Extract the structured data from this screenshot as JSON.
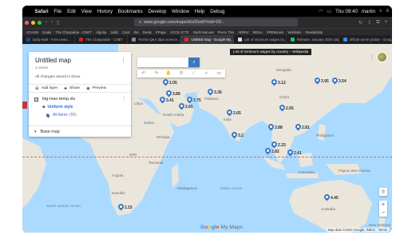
{
  "menubar": {
    "app": "Safari",
    "items": [
      "File",
      "Edit",
      "View",
      "History",
      "Bookmarks",
      "Develop",
      "Window",
      "Help",
      "Debug"
    ],
    "clock": "Thu 09:40",
    "user": "martin"
  },
  "browser": {
    "url": "www.google.com/maps/d/u/0/edit?mid=1R...",
    "favorites": [
      "4CANN",
      "Goals",
      "The Chaspalde - CNET",
      "Algolia",
      "Jalliz",
      "Card",
      "Ski",
      "Deals",
      "PPage",
      "ACCE-ICTE",
      "Dash Manual",
      "Press This",
      "ARRIV",
      "MESA",
      "#REMsuss",
      "Wikilinks",
      "Readability"
    ],
    "tabs": [
      {
        "label": "Daily Mail - Free news...",
        "active": false
      },
      {
        "label": "The Chaspadde - CNET",
        "active": false
      },
      {
        "label": "Techie Q&A data science...",
        "active": false
      },
      {
        "label": "Untitled map - Google My...",
        "active": true
      },
      {
        "label": "List of minimum wages by...",
        "active": false
      },
      {
        "label": "Release: January 2020 data...",
        "active": false
      },
      {
        "label": "official name jordan - Google...",
        "active": false
      }
    ]
  },
  "panel": {
    "title": "Untitled map",
    "views": "4 views",
    "saved": "All changes saved in Drive",
    "actions": {
      "add_layer": "Add layer",
      "share": "Share",
      "preview": "Preview"
    },
    "layer": {
      "name": "big-mac-temp.xls",
      "style": "Uniform style",
      "items_label": "All items",
      "items_count": "(55)"
    },
    "base_map": "Base map"
  },
  "tooltip": "List of minimum wages by country – Wikipedia",
  "logo": {
    "google": [
      "G",
      "o",
      "o",
      "g",
      "l",
      "e"
    ],
    "suffix": " My Maps"
  },
  "copyright": "Map data ©2020 Google, INEGI · Terms",
  "geo_labels": {
    "libya": "Libya",
    "south_arabia": "South Arabia",
    "pakistan": "Pakistan",
    "india": "India",
    "sudan": "Sudan",
    "nigeria": "Nigeria",
    "ethiopia": "Ethiopia",
    "drc": "DRC",
    "tanzania": "Tanzania",
    "angola": "Angola",
    "namibia": "Namibia",
    "madagascar": "Madagascar",
    "south_africa": "South Africa",
    "south_atlantic": "South Atlantic Ocean",
    "indian_ocean": "Indian Ocean",
    "australia": "Australia",
    "indonesia": "Indonesia",
    "papua": "Papua New Guinea",
    "mongolia": "Mongolia",
    "china": "China",
    "philippines": "Philippines",
    "new_zealand": "New Zealand"
  },
  "pins": [
    {
      "id": "pin-turkey",
      "value": "3.89"
    },
    {
      "id": "pin-russia",
      "value": "2.05"
    },
    {
      "id": "pin-pakistan",
      "value": "3.36"
    },
    {
      "id": "pin-saudi",
      "value": "2.65"
    },
    {
      "id": "pin-egypt",
      "value": "3.41"
    },
    {
      "id": "pin-uae",
      "value": "3.75"
    },
    {
      "id": "pin-india",
      "value": "2.65"
    },
    {
      "id": "pin-srilanka",
      "value": "3.2"
    },
    {
      "id": "pin-china",
      "value": "3.12"
    },
    {
      "id": "pin-korea",
      "value": "3.95"
    },
    {
      "id": "pin-japan",
      "value": "3.54"
    },
    {
      "id": "pin-hk",
      "value": "2.65"
    },
    {
      "id": "pin-thailand",
      "value": "3.88"
    },
    {
      "id": "pin-vietnam",
      "value": "2.81"
    },
    {
      "id": "pin-malaysia",
      "value": "2.33"
    },
    {
      "id": "pin-indonesia",
      "value": "2.41"
    },
    {
      "id": "pin-singapore",
      "value": "2.82"
    },
    {
      "id": "pin-australia",
      "value": "4.45"
    },
    {
      "id": "pin-southafrica",
      "value": "2.15"
    }
  ],
  "colors": {
    "pin": "#3b78c2",
    "water": "#aadaff",
    "land": "#eae6dc",
    "gridline": "#c23b3b"
  }
}
